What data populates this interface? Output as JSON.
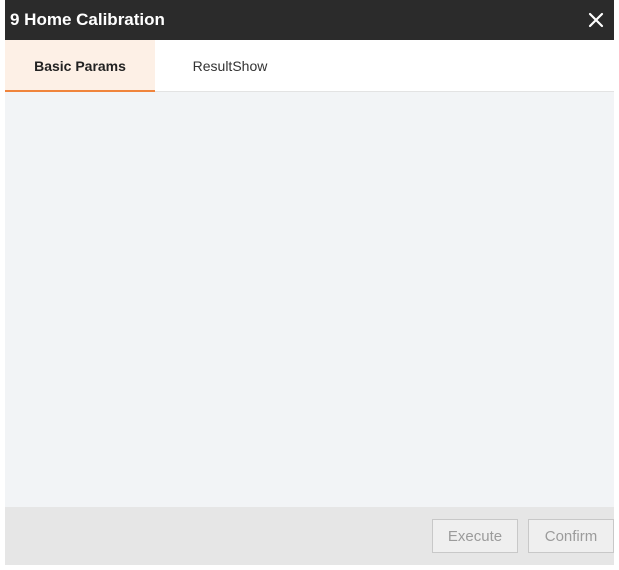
{
  "window": {
    "title": "9 Home Calibration",
    "close_icon": "close-icon"
  },
  "tabs": [
    {
      "label": "Basic Params",
      "active": true
    },
    {
      "label": "ResultShow",
      "active": false
    }
  ],
  "footer": {
    "execute_label": "Execute",
    "confirm_label": "Confirm",
    "execute_disabled": true,
    "confirm_disabled": true
  },
  "colors": {
    "titlebar": "#2b2b2b",
    "accent": "#f0843c",
    "content_bg": "#f2f4f6"
  }
}
